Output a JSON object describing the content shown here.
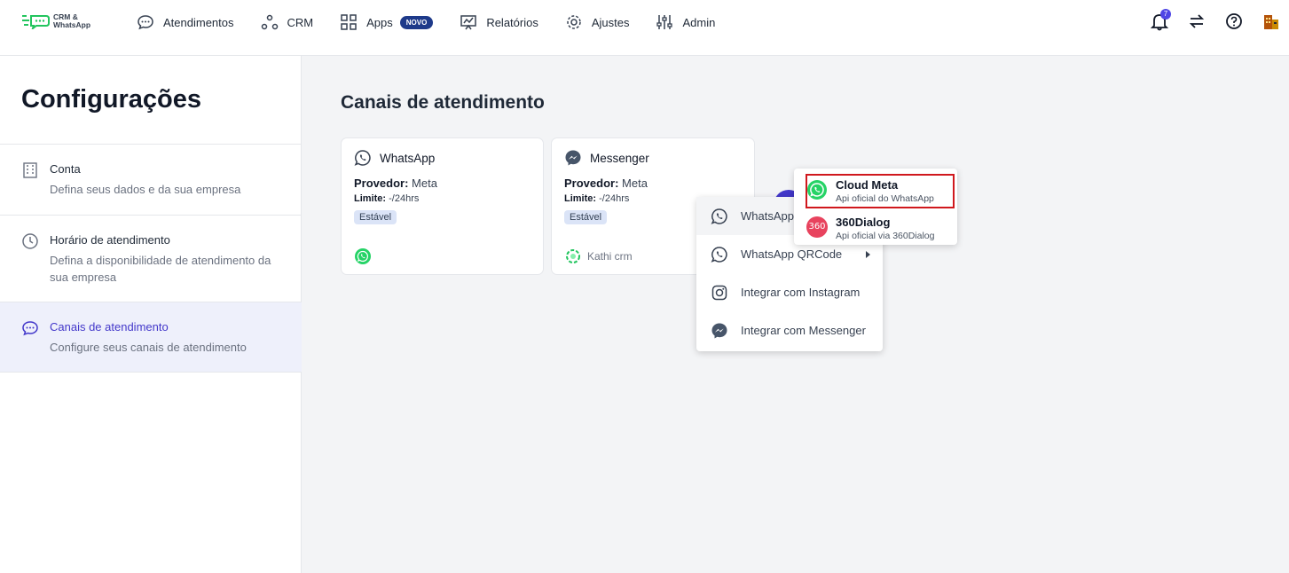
{
  "app": {
    "logo_text_1": "CRM &",
    "logo_text_2": "WhatsApp"
  },
  "nav": {
    "items": [
      {
        "label": "Atendimentos",
        "icon": "chat-bubble-icon"
      },
      {
        "label": "CRM",
        "icon": "crm-nodes-icon"
      },
      {
        "label": "Apps",
        "icon": "grid-icon",
        "badge": "NOVO"
      },
      {
        "label": "Relatórios",
        "icon": "chart-board-icon"
      },
      {
        "label": "Ajustes",
        "icon": "gear-icon"
      },
      {
        "label": "Admin",
        "icon": "sliders-icon"
      }
    ],
    "notification_count": "7"
  },
  "sidebar": {
    "title": "Configurações",
    "items": [
      {
        "title": "Conta",
        "desc": "Defina seus dados e da sua empresa",
        "icon": "building-icon"
      },
      {
        "title": "Horário de atendimento",
        "desc": "Defina a disponibilidade de atendimento da sua empresa",
        "icon": "clock-icon"
      },
      {
        "title": "Canais de atendimento",
        "desc": "Configure seus canais de atendimento",
        "icon": "chat-bubble-icon",
        "active": true
      }
    ]
  },
  "main": {
    "title": "Canais de atendimento",
    "cards": [
      {
        "name": "WhatsApp",
        "provider_label": "Provedor:",
        "provider": "Meta",
        "limit_label": "Limite:",
        "limit": "-/24hrs",
        "status": "Estável",
        "footer": ""
      },
      {
        "name": "Messenger",
        "provider_label": "Provedor:",
        "provider": "Meta",
        "limit_label": "Limite:",
        "limit": "-/24hrs",
        "status": "Estável",
        "footer": "Kathi crm"
      }
    ]
  },
  "menu": {
    "items": [
      {
        "label": "WhatsApp",
        "icon": "whatsapp-icon"
      },
      {
        "label": "WhatsApp QRCode",
        "icon": "whatsapp-icon"
      },
      {
        "label": "Integrar com Instagram",
        "icon": "instagram-icon"
      },
      {
        "label": "Integrar com Messenger",
        "icon": "messenger-icon"
      }
    ]
  },
  "submenu": {
    "items": [
      {
        "title": "Cloud Meta",
        "desc": "Api oficial do WhatsApp",
        "icon": "whatsapp-icon"
      },
      {
        "title": "360Dialog",
        "desc": "Api oficial via 360Dialog",
        "icon": "360dialog-icon",
        "icon_text": "360"
      }
    ]
  },
  "colors": {
    "accent": "#4338ca",
    "whatsapp": "#25d366",
    "highlight": "#d0181d"
  }
}
